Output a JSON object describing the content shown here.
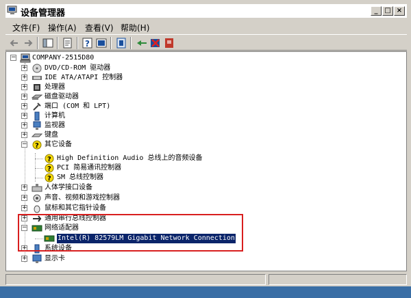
{
  "window": {
    "title": "设备管理器"
  },
  "menu": {
    "items": [
      "文件(F)",
      "操作(A)",
      "查看(V)",
      "帮助(H)"
    ]
  },
  "toolbar": {
    "buttons": [
      "back-icon",
      "forward-icon",
      "show-hide-tree-icon",
      "properties-icon",
      "help-icon",
      "refresh-icon",
      "print-icon",
      "scan-hardware-icon",
      "disable-device-icon",
      "uninstall-device-icon"
    ]
  },
  "tree": {
    "root": "COMPANY-2515D80",
    "items": [
      "DVD/CD-ROM 驱动器",
      "IDE ATA/ATAPI 控制器",
      "处理器",
      "磁盘驱动器",
      "端口 (COM 和 LPT)",
      "计算机",
      "监视器",
      "键盘",
      "其它设备",
      "High Definition Audio 总线上的音频设备",
      "PCI 简易通讯控制器",
      "SM 总线控制器",
      "人体学接口设备",
      "声音、视频和游戏控制器",
      "鼠标和其它指针设备",
      "通用串行总线控制器",
      "网络适配器",
      "Intel(R) 82579LM Gigabit Network Connection",
      "系统设备",
      "显示卡"
    ]
  },
  "colors": {
    "selection": "#0a246a",
    "highlight_box": "#d81e1e",
    "warning": "#f5d90a"
  }
}
